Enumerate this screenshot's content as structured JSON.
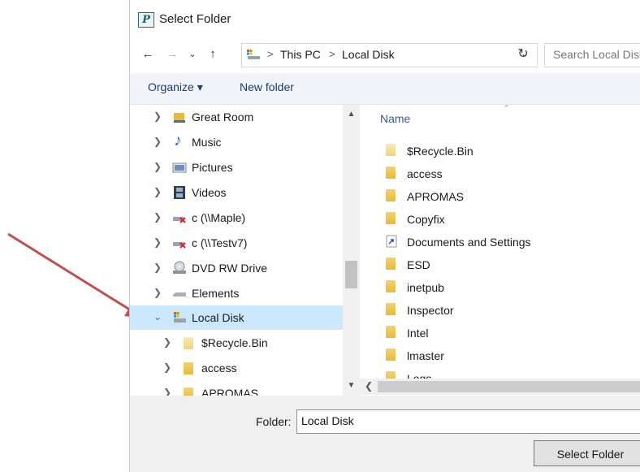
{
  "window": {
    "title": "Select Folder",
    "app_icon_letter": "P"
  },
  "address_bar": {
    "crumbs": [
      "This PC",
      "Local Disk"
    ],
    "separator": ">"
  },
  "search": {
    "placeholder": "Search Local Disk"
  },
  "toolbar": {
    "organize_label": "Organize ▾",
    "new_folder_label": "New folder"
  },
  "nav_pane": {
    "items": [
      {
        "label": "Great Room",
        "icon": "network-folder-icon",
        "expanded": false
      },
      {
        "label": "Music",
        "icon": "music-note-icon",
        "expanded": false
      },
      {
        "label": "Pictures",
        "icon": "pictures-icon",
        "expanded": false
      },
      {
        "label": "Videos",
        "icon": "film-strip-icon",
        "expanded": false
      },
      {
        "label": "c (\\\\Maple)",
        "icon": "disconnected-drive-icon",
        "expanded": false
      },
      {
        "label": "c (\\\\Testv7)",
        "icon": "disconnected-drive-icon",
        "expanded": false
      },
      {
        "label": "DVD RW Drive",
        "icon": "dvd-drive-icon",
        "expanded": false
      },
      {
        "label": "Elements",
        "icon": "drive-icon",
        "expanded": false
      },
      {
        "label": "Local Disk",
        "icon": "windows-drive-icon",
        "expanded": true,
        "selected": true
      },
      {
        "label": "$Recycle.Bin",
        "icon": "folder-light-icon",
        "expanded": false
      },
      {
        "label": "access",
        "icon": "folder-icon",
        "expanded": false
      },
      {
        "label": "APROMAS",
        "icon": "folder-icon",
        "expanded": false
      }
    ]
  },
  "file_list": {
    "column_name": "Name",
    "items": [
      {
        "name": "$Recycle.Bin",
        "icon": "folder-light-icon"
      },
      {
        "name": "access",
        "icon": "folder-icon"
      },
      {
        "name": "APROMAS",
        "icon": "folder-icon"
      },
      {
        "name": "Copyfix",
        "icon": "folder-icon"
      },
      {
        "name": "Documents and Settings",
        "icon": "shortcut-icon"
      },
      {
        "name": "ESD",
        "icon": "folder-icon"
      },
      {
        "name": "inetpub",
        "icon": "folder-icon"
      },
      {
        "name": "Inspector",
        "icon": "folder-icon"
      },
      {
        "name": "Intel",
        "icon": "folder-icon"
      },
      {
        "name": "lmaster",
        "icon": "folder-icon"
      },
      {
        "name": "Logs",
        "icon": "folder-icon"
      }
    ]
  },
  "footer": {
    "folder_label": "Folder:",
    "folder_value": "Local Disk",
    "select_button": "Select Folder"
  },
  "colors": {
    "selection": "#cce8ff",
    "annotation_arrow": "#c0504d",
    "folder": "#e8b93b"
  }
}
